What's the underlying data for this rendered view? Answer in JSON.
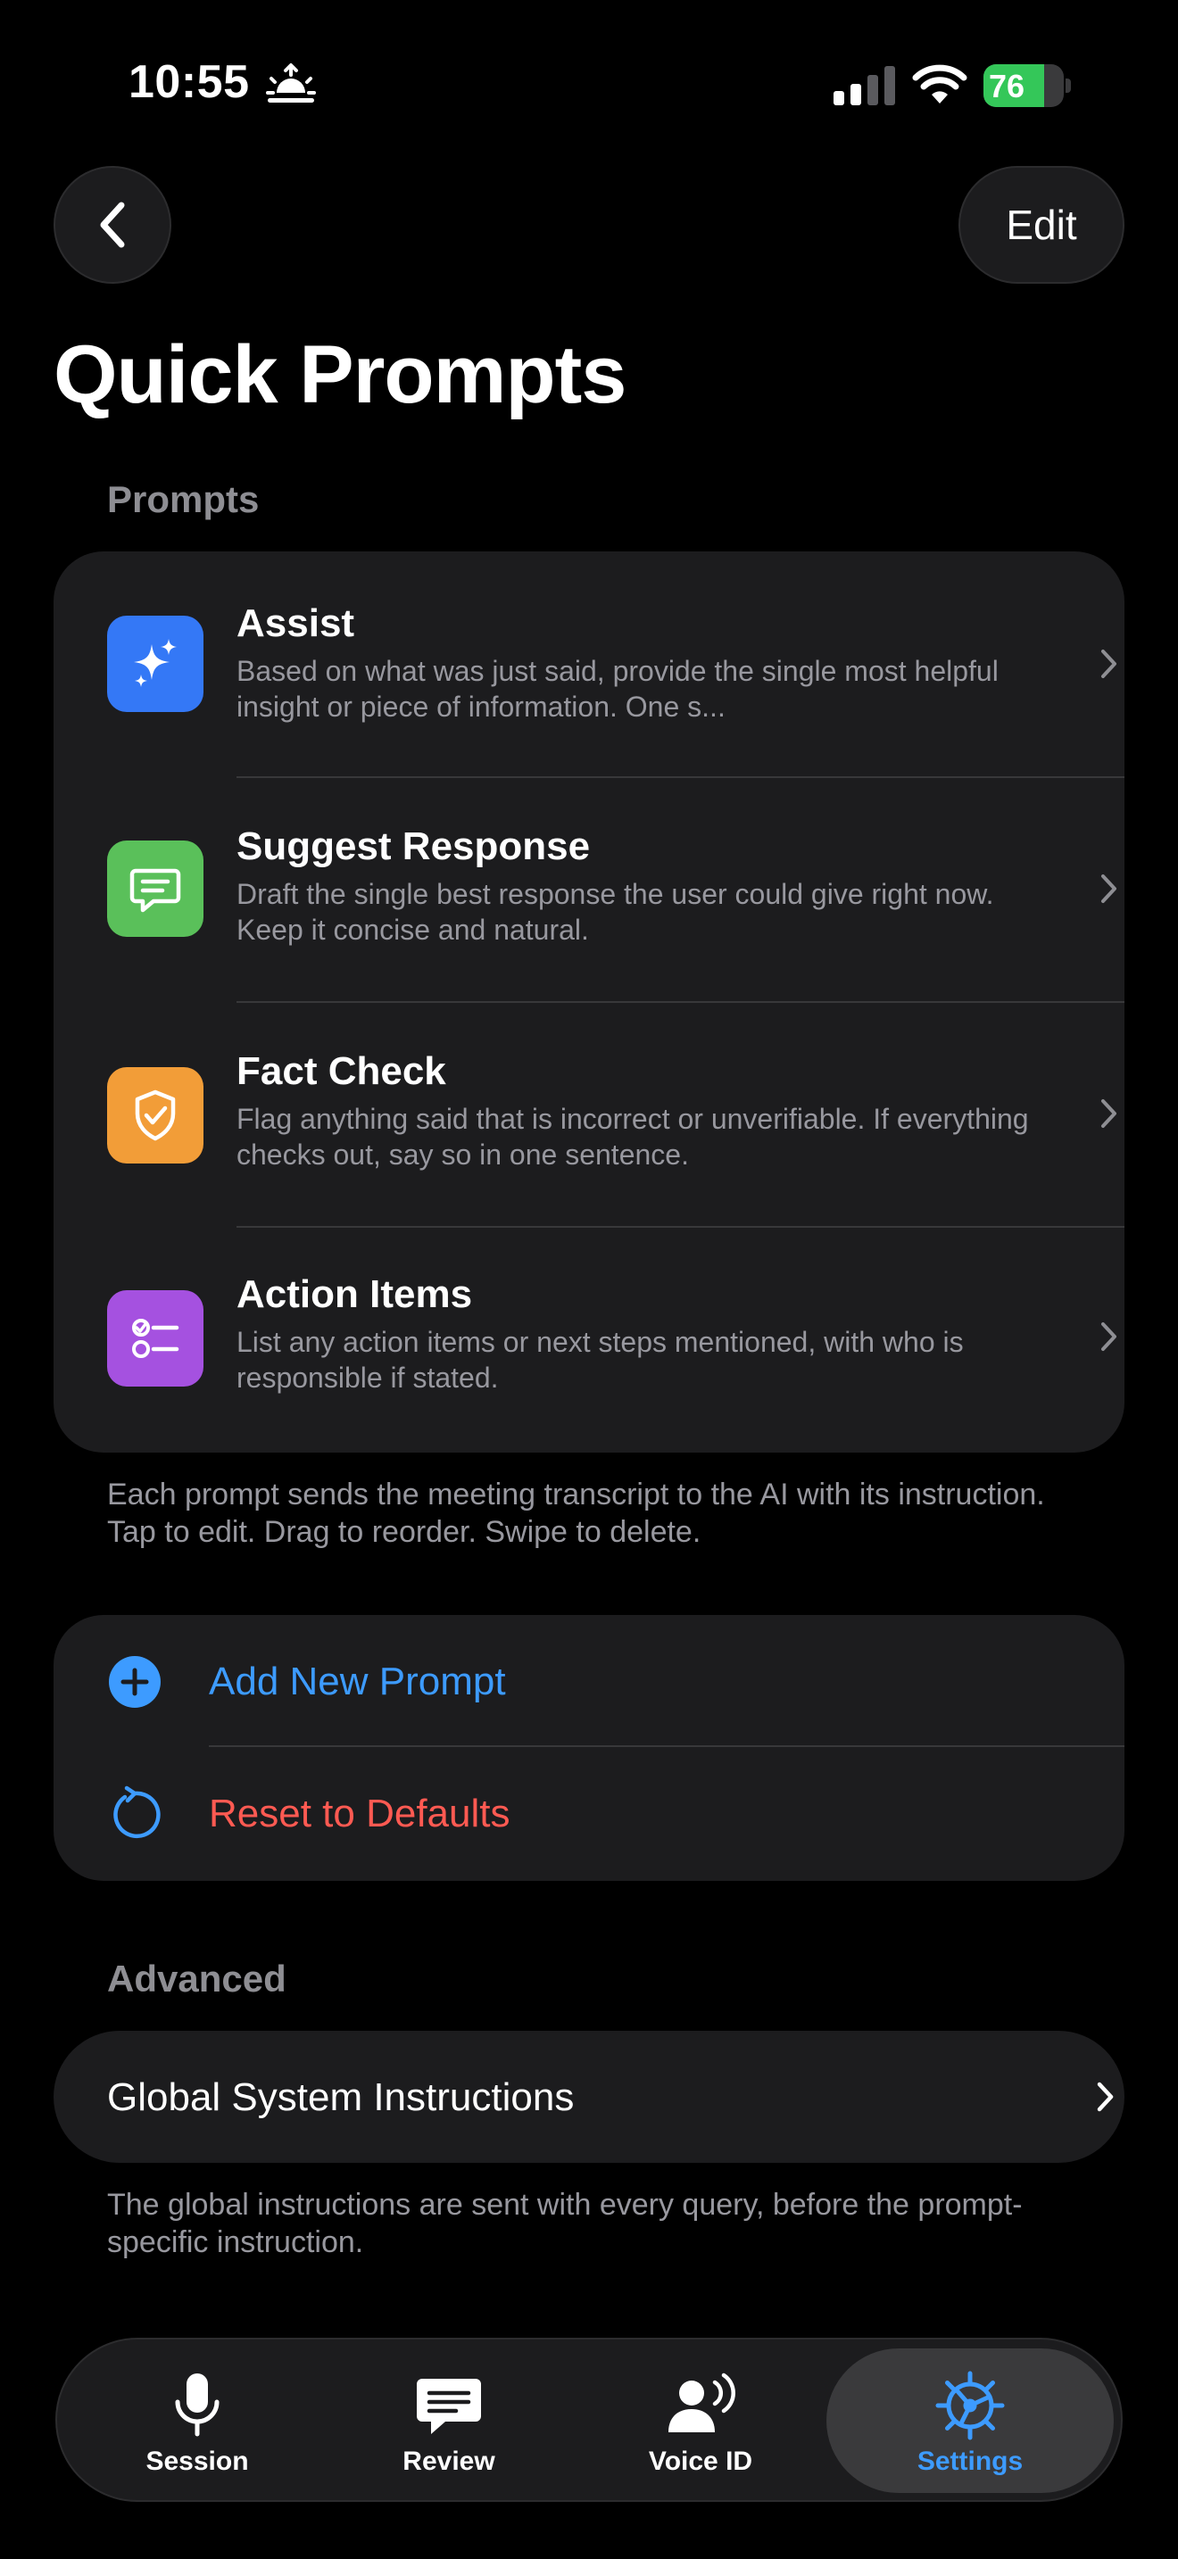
{
  "status_bar": {
    "time": "10:55",
    "battery": "76",
    "battery_level": 0.76
  },
  "nav": {
    "edit_label": "Edit"
  },
  "title": "Quick Prompts",
  "prompts_section": {
    "header": "Prompts",
    "items": [
      {
        "title": "Assist",
        "description": "Based on what was just said, provide the single most helpful insight or piece of information. One s...",
        "icon": "sparkles-icon",
        "color": "#3478f6"
      },
      {
        "title": "Suggest Response",
        "description": "Draft the single best response the user could give right now. Keep it concise and natural.",
        "icon": "speech-bubble-icon",
        "color": "#5ac05a"
      },
      {
        "title": "Fact Check",
        "description": "Flag anything said that is incorrect or unverifiable. If everything checks out, say so in one sentence.",
        "icon": "shield-check-icon",
        "color": "#f29d38"
      },
      {
        "title": "Action Items",
        "description": "List any action items or next steps mentioned, with who is responsible if stated.",
        "icon": "checklist-icon",
        "color": "#a551e0"
      }
    ],
    "footnote": "Each prompt sends the meeting transcript to the AI with its instruction. Tap to edit. Drag to reorder. Swipe to delete."
  },
  "actions": {
    "add_label": "Add New Prompt",
    "reset_label": "Reset to Defaults",
    "add_color": "#3d9bff",
    "reset_color": "#ff5a52"
  },
  "advanced_section": {
    "header": "Advanced",
    "global_label": "Global System Instructions",
    "footnote": "The global instructions are sent with every query, before the prompt-specific instruction."
  },
  "tabbar": {
    "tabs": [
      {
        "label": "Session",
        "icon": "microphone-icon"
      },
      {
        "label": "Review",
        "icon": "message-icon"
      },
      {
        "label": "Voice ID",
        "icon": "person-voice-icon"
      },
      {
        "label": "Settings",
        "icon": "gear-icon"
      }
    ],
    "active": "Settings"
  }
}
